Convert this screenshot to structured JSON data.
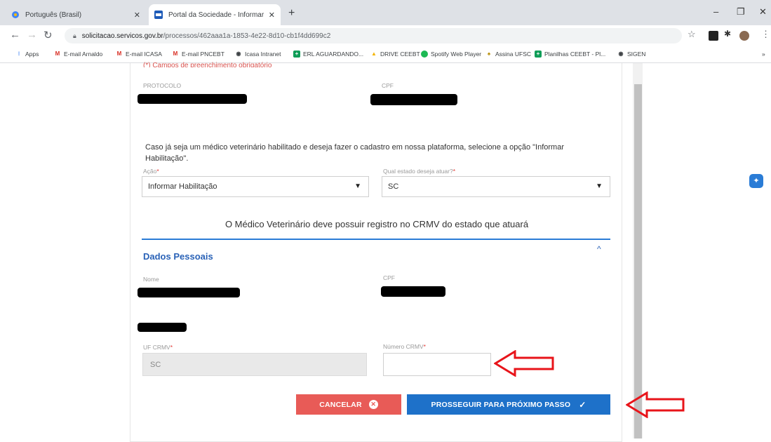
{
  "browser": {
    "tabs": [
      {
        "title": "Português (Brasil)",
        "active": false
      },
      {
        "title": "Portal da Sociedade - Informar T",
        "active": true
      }
    ],
    "new_tab": "+",
    "url_host": "solicitacao.servicos.gov.br",
    "url_path": "/processos/462aaa1a-1853-4e22-8d10-cb1f4dd699c2",
    "bookmarks": [
      {
        "label": "Apps",
        "icon": "apps-grid-icon",
        "color": "#4285f4"
      },
      {
        "label": "E-mail Arnaldo",
        "icon": "gmail-icon",
        "color": "#d93025"
      },
      {
        "label": "E-mail ICASA",
        "icon": "gmail-icon",
        "color": "#d93025"
      },
      {
        "label": "E-mail PNCEBT",
        "icon": "gmail-icon",
        "color": "#d93025"
      },
      {
        "label": "Icasa Intranet",
        "icon": "globe-icon",
        "color": "#3c4043"
      },
      {
        "label": "ERL AGUARDANDO...",
        "icon": "sheets-icon",
        "color": "#0f9d58"
      },
      {
        "label": "DRIVE CEEBT",
        "icon": "drive-icon",
        "color": "#f4b400"
      },
      {
        "label": "Spotify Web Player",
        "icon": "spotify-icon",
        "color": "#1db954"
      },
      {
        "label": "Assina UFSC",
        "icon": "assina-icon",
        "color": "#b58b00"
      },
      {
        "label": "Planilhas CEEBT - Pl...",
        "icon": "sheets-icon",
        "color": "#0f9d58"
      },
      {
        "label": "SIGEN",
        "icon": "globe-icon",
        "color": "#3c4043"
      }
    ],
    "more_bookmarks": "»"
  },
  "form": {
    "required_note": "(*) Campos de preenchimento obrigatório",
    "protocolo_label": "PROTOCOLO",
    "cpf_label_top": "CPF",
    "info_text": "Caso já seja um médico veterinário habilitado e deseja fazer o cadastro em nossa plataforma, selecione a opção \"Informar Habilitação\".",
    "acao_label": "Ação",
    "acao_value": "Informar Habilitação",
    "estado_label": "Qual estado deseja atuar?",
    "estado_value": "SC",
    "required_mark": "*",
    "notice": "O Médico Veterinário deve possuir registro no CRMV do estado que atuará",
    "section_title": "Dados Pessoais",
    "nome_label": "Nome",
    "cpf_label": "CPF",
    "uf_crmv_label": "UF CRMV",
    "uf_crmv_value": "SC",
    "numero_crmv_label": "Número CRMV",
    "numero_crmv_value": "",
    "cancel_label": "CANCELAR",
    "next_label": "PROSSEGUIR PARA PRÓXIMO PASSO"
  },
  "colors": {
    "accent": "#1e71c9",
    "danger": "#e85b57",
    "annotation": "#e8141a"
  }
}
